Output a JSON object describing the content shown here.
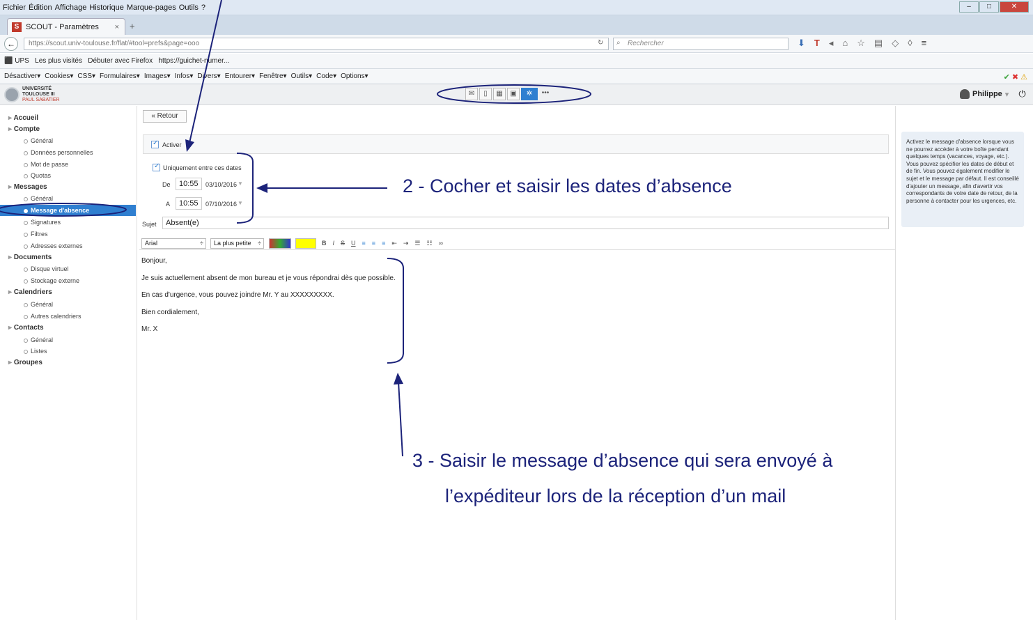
{
  "browser": {
    "menu": [
      "Fichier",
      "Édition",
      "Affichage",
      "Historique",
      "Marque-pages",
      "Outils",
      "?"
    ],
    "tab_title": "SCOUT - Paramètres",
    "url": "https://scout.univ-toulouse.fr/flat/#tool=prefs&page=ooo",
    "search_placeholder": "Rechercher",
    "bookmarks": [
      "UPS",
      "Les plus visités",
      "Débuter avec Firefox",
      "https://guichet-numer..."
    ],
    "webdev": [
      "Désactiver▾",
      "Cookies▾",
      "CSS▾",
      "Formulaires▾",
      "Images▾",
      "Infos▾",
      "Divers▾",
      "Entourer▾",
      "Fenêtre▾",
      "Outils▾",
      "Code▾",
      "Options▾"
    ]
  },
  "app": {
    "logo_line1": "UNIVERSITÉ",
    "logo_line2": "TOULOUSE III",
    "logo_line3": "PAUL SABATIER",
    "user": "Philippe"
  },
  "sidebar": {
    "items": [
      {
        "label": "Accueil",
        "kind": "section"
      },
      {
        "label": "Compte",
        "kind": "section"
      },
      {
        "label": "Général",
        "kind": "item"
      },
      {
        "label": "Données personnelles",
        "kind": "item"
      },
      {
        "label": "Mot de passe",
        "kind": "item"
      },
      {
        "label": "Quotas",
        "kind": "item"
      },
      {
        "label": "Messages",
        "kind": "section"
      },
      {
        "label": "Général",
        "kind": "item"
      },
      {
        "label": "Message d'absence",
        "kind": "active"
      },
      {
        "label": "Signatures",
        "kind": "item"
      },
      {
        "label": "Filtres",
        "kind": "item"
      },
      {
        "label": "Adresses externes",
        "kind": "item"
      },
      {
        "label": "Documents",
        "kind": "section"
      },
      {
        "label": "Disque virtuel",
        "kind": "item"
      },
      {
        "label": "Stockage externe",
        "kind": "item"
      },
      {
        "label": "Calendriers",
        "kind": "section"
      },
      {
        "label": "Général",
        "kind": "item"
      },
      {
        "label": "Autres calendriers",
        "kind": "item"
      },
      {
        "label": "Contacts",
        "kind": "section"
      },
      {
        "label": "Général",
        "kind": "item"
      },
      {
        "label": "Listes",
        "kind": "item"
      },
      {
        "label": "Groupes",
        "kind": "section"
      }
    ]
  },
  "form": {
    "back": "« Retour",
    "activer": "Activer",
    "dates_only": "Uniquement entre ces dates",
    "de_label": "De",
    "de_time": "10:55",
    "de_date": "03/10/2016",
    "a_label": "A",
    "a_time": "10:55",
    "a_date": "07/10/2016",
    "sujet_label": "Sujet",
    "sujet_value": "Absent(e)"
  },
  "editor": {
    "font": "Arial",
    "size": "La plus petite",
    "lines": [
      "Bonjour,",
      "Je suis actuellement absent de mon bureau et je vous répondrai dès que possible.",
      "En cas d'urgence, vous pouvez joindre Mr. Y au XXXXXXXXX.",
      "Bien cordialement,",
      "Mr. X"
    ]
  },
  "help": {
    "text": "Activez le message d'absence lorsque vous ne pourrez accéder à votre boîte pendant quelques temps (vacances, voyage, etc.). Vous pouvez spécifier les dates de début et de fin. Vous pouvez également modifier le sujet et le message par défaut. Il est conseillé d'ajouter un message, afin d'avertir vos correspondants de votre date de retour, de la personne à contacter pour les urgences, etc."
  },
  "annotations": {
    "step2": "2 - Cocher et saisir les dates d’absence",
    "step3_line1": "3 - Saisir le message d’absence qui sera envoyé à",
    "step3_line2": "l’expéditeur lors de la réception d’un mail",
    "color": "#1c237a"
  }
}
